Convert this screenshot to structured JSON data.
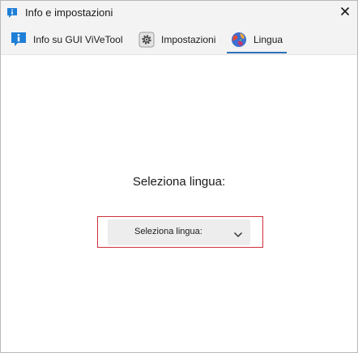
{
  "window": {
    "title": "Info e impostazioni",
    "title_icon": "info-speech-bubble-icon",
    "close_icon": "close-icon"
  },
  "tabs": [
    {
      "label": "Info su GUI ViVeTool",
      "icon": "info-icon",
      "selected": false
    },
    {
      "label": "Impostazioni",
      "icon": "gear-icon",
      "selected": false
    },
    {
      "label": "Lingua",
      "icon": "globe-icon",
      "selected": true
    }
  ],
  "main": {
    "heading": "Seleziona lingua:",
    "language_select": {
      "value": "Seleziona lingua:",
      "icon": "chevron-down-icon"
    }
  },
  "colors": {
    "accent": "#2b6fb8",
    "highlight_border": "#d0313a",
    "tabbar_background": "#f3f3f3",
    "dropdown_background": "#ededed"
  }
}
